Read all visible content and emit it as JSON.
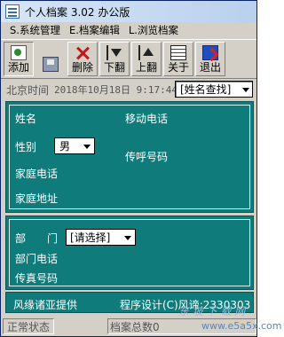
{
  "window": {
    "title": "个人档案 3.02 办公版"
  },
  "menu": {
    "items": [
      "S.系统管理",
      "E.档案编辑",
      "L.浏览档案"
    ]
  },
  "toolbar": {
    "add": "添加",
    "save": "",
    "delete": "删除",
    "next": "下翻",
    "prev": "上翻",
    "about": "关于",
    "exit": "退出"
  },
  "datebar": {
    "label": "北京时间",
    "value": "2018年10月18日  9:17:44",
    "search_select": "[姓名查找]"
  },
  "personal": {
    "name_label": "姓名",
    "mobile_label": "移动电话",
    "gender_label": "性别",
    "gender_value": "男",
    "pager_label": "传呼号码",
    "home_phone_label": "家庭电话",
    "home_address_label": "家庭地址"
  },
  "department": {
    "dept_label": "部　　门",
    "dept_value": "[请选择]",
    "dept_phone_label": "部门电话",
    "fax_label": "传真号码"
  },
  "footer": {
    "provider": "风缘诸亚提供",
    "designer": "程序设计(C)风谛:2330303"
  },
  "statusbar": {
    "status": "正常状态",
    "record_count": "档案总数0"
  },
  "watermark": {
    "text": "东 坡 下 载 网",
    "url": "www.e5a5x.com"
  }
}
